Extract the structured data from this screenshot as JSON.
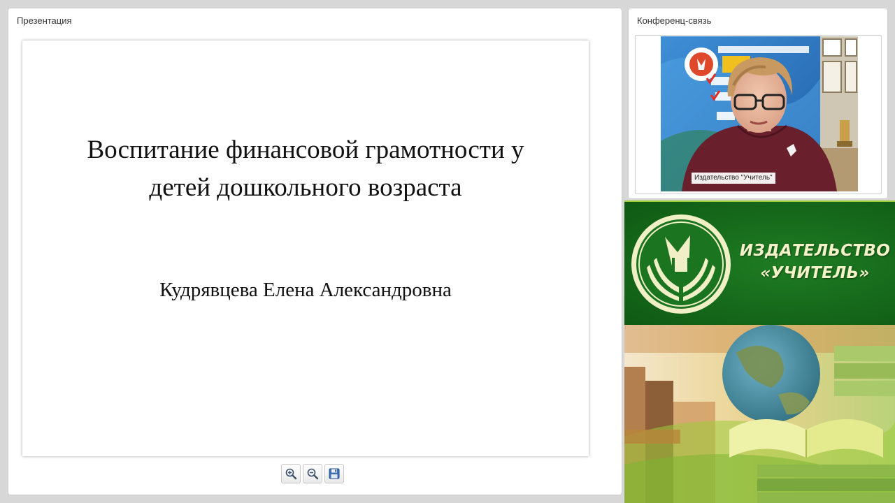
{
  "presentation": {
    "panel_title": "Презентация",
    "slide": {
      "title": "Воспитание финансовой грамотности у детей дошкольного возраста",
      "author": "Кудрявцева Елена Александровна"
    },
    "toolbar": {
      "zoom_in_icon": "zoom-in-icon",
      "zoom_out_icon": "zoom-out-icon",
      "save_icon": "floppy-disk-icon"
    }
  },
  "conference": {
    "panel_title": "Конференц-связь",
    "video_label": "Издательство \"Учитель\""
  },
  "banner": {
    "name_line1": "ИЗДАТЕЛЬСТВО",
    "name_line2": "«УЧИТЕЛЬ»",
    "accent_color": "#1b7220",
    "text_color": "#f3f2c8"
  }
}
